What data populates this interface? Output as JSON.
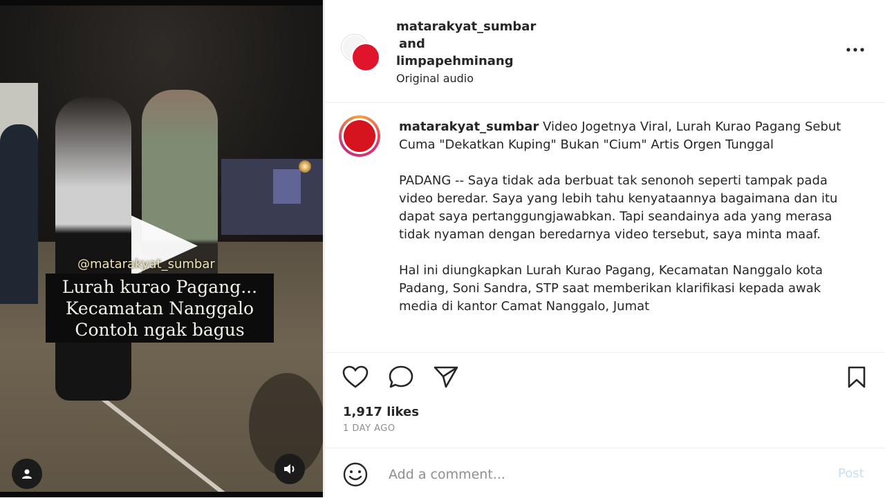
{
  "video": {
    "watermark": "@matarakyat_sumbar",
    "caption_lines": [
      "Lurah kurao Pagang...",
      "Kecamatan Nanggalo",
      "Contoh ngak bagus"
    ]
  },
  "header": {
    "user1": "matarakyat_sumbar",
    "and": "and",
    "user2": "limpapehminang",
    "audio": "Original audio"
  },
  "caption": {
    "username": "matarakyat_sumbar",
    "title": "Video Jogetnya Viral, Lurah Kurao Pagang Sebut Cuma \"Dekatkan Kuping\" Bukan \"Cium\" Artis Orgen Tunggal",
    "para1": "PADANG -- Saya tidak ada berbuat tak senonoh seperti tampak pada video beredar. Saya yang lebih tahu kenyataannya bagaimana dan itu dapat saya pertanggungjawabkan. Tapi seandainya ada yang merasa tidak nyaman dengan beredarnya video tersebut, saya minta maaf.",
    "para2": "Hal ini diungkapkan Lurah Kurao Pagang, Kecamatan Nanggalo kota Padang, Soni Sandra, STP saat memberikan klarifikasi kepada awak media di kantor Camat Nanggalo, Jumat"
  },
  "stats": {
    "likes": "1,917 likes",
    "time": "1 DAY AGO"
  },
  "comment": {
    "placeholder": "Add a comment...",
    "post_label": "Post"
  },
  "icons": {
    "more": "more-options-icon",
    "like": "heart-icon",
    "comment": "comment-icon",
    "share": "send-icon",
    "save": "bookmark-icon",
    "emoji": "emoji-icon",
    "user": "user-icon",
    "mute": "speaker-icon",
    "play": "play-icon"
  },
  "colors": {
    "accent_red": "#e0142b",
    "post_disabled": "#c7e0f4",
    "muted_text": "#8e8e8e"
  }
}
